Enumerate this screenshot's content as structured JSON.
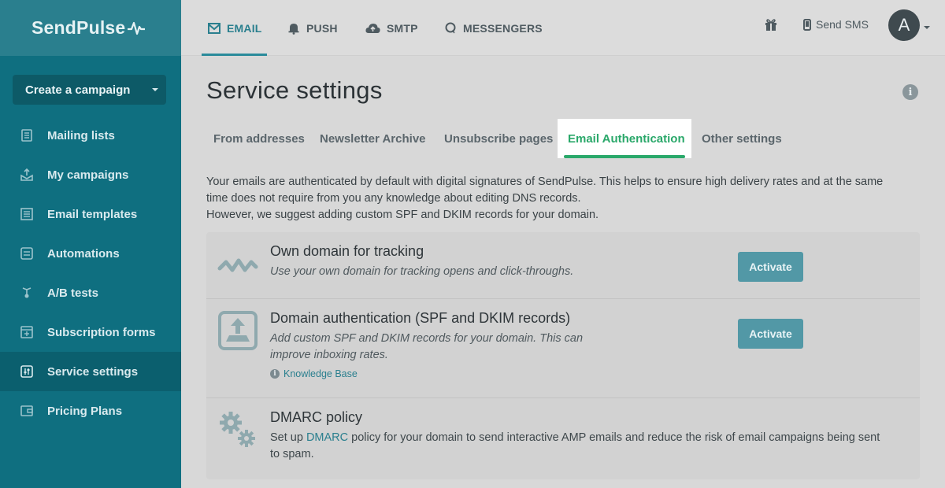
{
  "brand": {
    "name": "SendPulse"
  },
  "sidebar": {
    "create_label": "Create a campaign",
    "items": [
      {
        "label": "Mailing lists",
        "icon": "mailing-lists-icon"
      },
      {
        "label": "My campaigns",
        "icon": "campaigns-icon"
      },
      {
        "label": "Email templates",
        "icon": "templates-icon"
      },
      {
        "label": "Automations",
        "icon": "automations-icon"
      },
      {
        "label": "A/B tests",
        "icon": "ab-tests-icon"
      },
      {
        "label": "Subscription forms",
        "icon": "forms-icon"
      },
      {
        "label": "Service settings",
        "icon": "settings-icon",
        "active": true
      },
      {
        "label": "Pricing Plans",
        "icon": "wallet-icon"
      }
    ]
  },
  "topbar": {
    "tabs": [
      {
        "label": "EMAIL",
        "icon": "envelope-icon",
        "active": true
      },
      {
        "label": "PUSH",
        "icon": "bell-icon"
      },
      {
        "label": "SMTP",
        "icon": "cloud-upload-icon"
      },
      {
        "label": "MESSENGERS",
        "icon": "chat-icon"
      }
    ],
    "send_sms": "Send SMS",
    "avatar_letter": "A"
  },
  "main": {
    "title": "Service settings",
    "tabs": [
      {
        "label": "From addresses"
      },
      {
        "label": "Newsletter Archive"
      },
      {
        "label": "Unsubscribe pages"
      },
      {
        "label": "Email Authentication",
        "active": true
      },
      {
        "label": "Other settings"
      }
    ],
    "intro_line1": "Your emails are authenticated by default with digital signatures of SendPulse. This helps to ensure high delivery rates and at the same",
    "intro_line2": "time does not require from you any knowledge about editing DNS records.",
    "intro_line3": "However, we suggest adding custom SPF and DKIM records for your domain.",
    "rows": [
      {
        "title": "Own domain for tracking",
        "desc": "Use your own domain for tracking opens and click-throughs.",
        "button": "Activate"
      },
      {
        "title": "Domain authentication (SPF and DKIM records)",
        "desc_line1": "Add custom SPF and DKIM records for your domain. This can",
        "desc_line2": "improve inboxing rates.",
        "link": "Knowledge Base",
        "button": "Activate"
      },
      {
        "title": "DMARC policy",
        "desc_before": "Set up ",
        "desc_link": "DMARC",
        "desc_after": " policy for your domain to send interactive AMP emails and reduce the risk of email campaigns being sent",
        "desc_line2": "to spam."
      }
    ]
  },
  "colors": {
    "sidebar": "#0f6f80",
    "accent_green": "#2aa86a",
    "button": "#5298a6"
  }
}
